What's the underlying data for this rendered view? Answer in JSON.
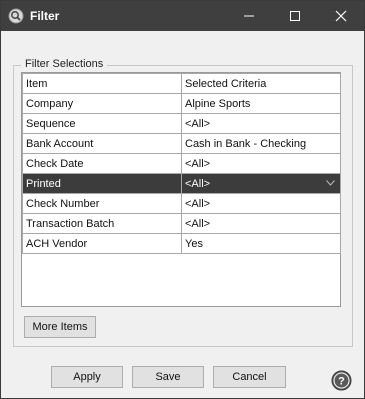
{
  "window": {
    "title": "Filter",
    "icon": "magnifier-icon",
    "controls": {
      "minimize": "minimize-icon",
      "maximize": "maximize-icon",
      "close": "close-icon"
    }
  },
  "group": {
    "legend": "Filter Selections"
  },
  "grid": {
    "headers": {
      "item": "Item",
      "criteria": "Selected Criteria"
    },
    "rows": [
      {
        "item": "Company",
        "criteria": "Alpine Sports"
      },
      {
        "item": "Sequence",
        "criteria": "<All>"
      },
      {
        "item": "Bank Account",
        "criteria": "Cash in Bank - Checking"
      },
      {
        "item": "Check Date",
        "criteria": "<All>"
      },
      {
        "item": "Printed",
        "criteria": "<All>",
        "selected": true
      },
      {
        "item": "Check Number",
        "criteria": "<All>"
      },
      {
        "item": "Transaction Batch",
        "criteria": "<All>"
      },
      {
        "item": "ACH Vendor",
        "criteria": "Yes"
      }
    ]
  },
  "buttons": {
    "more_items": "More Items",
    "apply": "Apply",
    "save": "Save",
    "cancel": "Cancel",
    "help": "help-icon"
  },
  "colors": {
    "titlebar": "#3f3f3f",
    "selected_row": "#3c3c3c",
    "window_bg": "#f0f0f0"
  }
}
